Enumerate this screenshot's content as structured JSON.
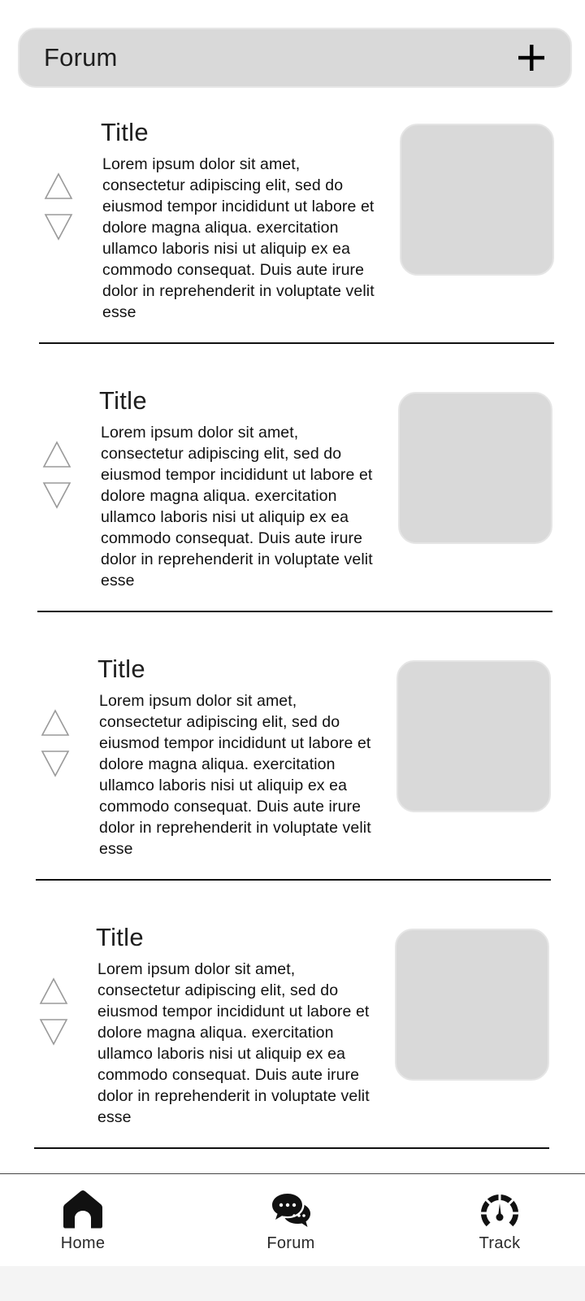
{
  "header": {
    "title": "Forum",
    "add_icon": "plus-icon"
  },
  "posts": [
    {
      "title": "Title",
      "body": "Lorem ipsum dolor sit amet, consectetur adipiscing elit, sed do eiusmod tempor incididunt ut labore et dolore magna aliqua. exercitation ullamco laboris nisi ut aliquip ex ea commodo consequat. Duis aute irure dolor in reprehenderit in voluptate velit esse"
    },
    {
      "title": "Title",
      "body": "Lorem ipsum dolor sit amet, consectetur adipiscing elit, sed do eiusmod tempor incididunt ut labore et dolore magna aliqua. exercitation ullamco laboris nisi ut aliquip ex ea commodo consequat. Duis aute irure dolor in reprehenderit in voluptate velit esse"
    },
    {
      "title": "Title",
      "body": "Lorem ipsum dolor sit amet, consectetur adipiscing elit, sed do eiusmod tempor incididunt ut labore et dolore magna aliqua. exercitation ullamco laboris nisi ut aliquip ex ea commodo consequat. Duis aute irure dolor in reprehenderit in voluptate velit esse"
    },
    {
      "title": "Title",
      "body": "Lorem ipsum dolor sit amet, consectetur adipiscing elit, sed do eiusmod tempor incididunt ut labore et dolore magna aliqua. exercitation ullamco laboris nisi ut aliquip ex ea commodo consequat. Duis aute irure dolor in reprehenderit in voluptate velit esse"
    }
  ],
  "nav": [
    {
      "label": "Home",
      "icon": "home-icon"
    },
    {
      "label": "Forum",
      "icon": "chat-bubbles-icon"
    },
    {
      "label": "Track",
      "icon": "speedometer-icon"
    }
  ],
  "colors": {
    "placeholder": "#d9d9d9",
    "text": "#1e1e1e",
    "vote_arrow": "#9a9a9a"
  }
}
